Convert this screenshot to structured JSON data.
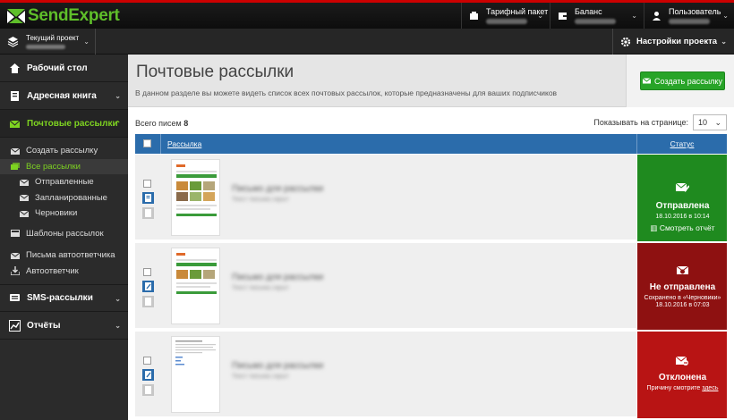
{
  "app": {
    "logo_text": "SendExpert",
    "topbar": {
      "tariff_label": "Тарифный пакет",
      "balance_label": "Баланс",
      "user_label": "Пользователь"
    },
    "project_label": "Текущий проект",
    "settings_label": "Настройки проекта"
  },
  "sidebar": {
    "dashboard": "Рабочий стол",
    "addressbook": "Адресная книга",
    "mailings": "Почтовые рассылки",
    "create": "Создать рассылку",
    "all": "Все рассылки",
    "sent": "Отправленные",
    "scheduled": "Запланированные",
    "drafts": "Черновики",
    "templates": "Шаблоны рассылок",
    "autoletters": "Письма автоответчика",
    "autoresponder": "Автоответчик",
    "sms": "SMS-рассылки",
    "reports": "Отчёты"
  },
  "main": {
    "title": "Почтовые рассылки",
    "description": "В данном разделе вы можете видеть список всех почтовых рассылок, которые предназначены для ваших подписчиков",
    "create_button": "Создать рассылку",
    "total_label": "Всего писем",
    "total_count": "8",
    "perpage_label": "Показывать на странице:",
    "perpage_value": "10",
    "col_mailing": "Рассылка",
    "col_status": "Статус"
  },
  "rows": [
    {
      "title": "Письмо для рассылки",
      "snippet": "Текст письма скрыт",
      "status": "Отправлена",
      "date": "18.10.2016 в 10:14",
      "link": "Смотреть отчёт",
      "color": "#1f8a1f"
    },
    {
      "title": "Письмо для рассылки",
      "snippet": "Текст письма скрыт",
      "status": "Не отправлена",
      "note": "Сохранено в «Черновики»",
      "date": "18.10.2016 в 07:03",
      "color": "#8e1111"
    },
    {
      "title": "Письмо для рассылки",
      "snippet": "Текст письма скрыт",
      "status": "Отклонена",
      "note": "Причину смотрите",
      "link": "здесь",
      "color": "#b81414"
    }
  ]
}
